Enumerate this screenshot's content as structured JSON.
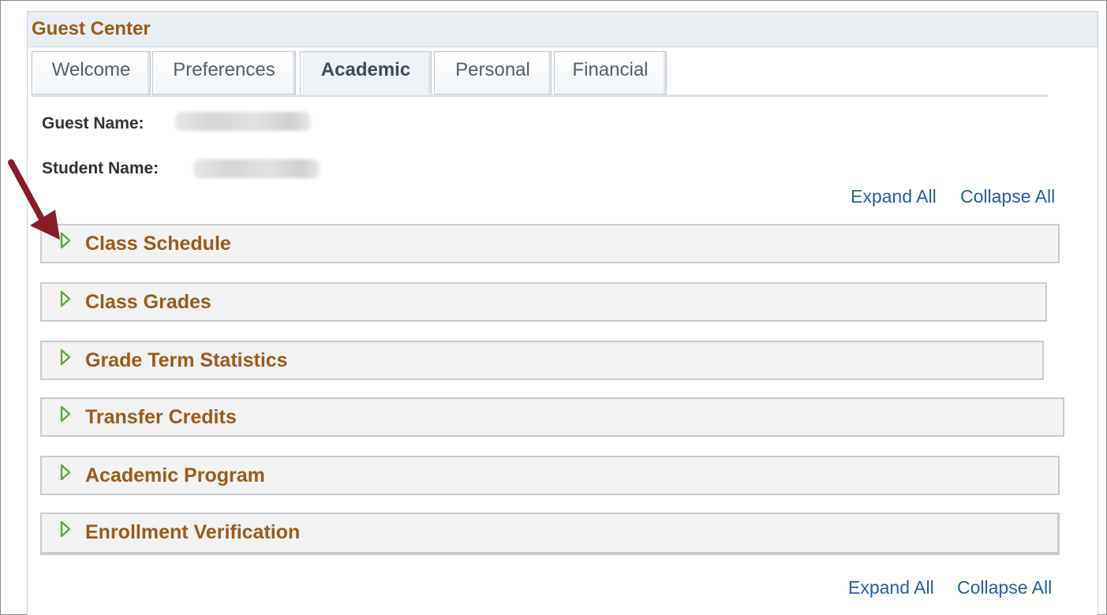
{
  "panel": {
    "title": "Guest Center"
  },
  "tabs": [
    {
      "label": "Welcome"
    },
    {
      "label": "Preferences"
    },
    {
      "label": "Academic"
    },
    {
      "label": "Personal"
    },
    {
      "label": "Financial"
    }
  ],
  "active_tab": "Academic",
  "guest": {
    "guest_name_label": "Guest Name:",
    "student_name_label": "Student Name:"
  },
  "controls": {
    "expand_all": "Expand All",
    "collapse_all": "Collapse All"
  },
  "sections": [
    {
      "label": "Class Schedule"
    },
    {
      "label": "Class Grades"
    },
    {
      "label": "Grade Term Statistics"
    },
    {
      "label": "Transfer Credits"
    },
    {
      "label": "Academic Program"
    },
    {
      "label": "Enrollment Verification"
    }
  ],
  "colors": {
    "section_title": "#9b5a1a",
    "link": "#235ea6",
    "chevron": "#5aa83a",
    "annotation_arrow": "#8b1a2b"
  },
  "icons": {
    "section_toggle": "chevron-right-icon",
    "annotation": "red-arrow-icon"
  }
}
